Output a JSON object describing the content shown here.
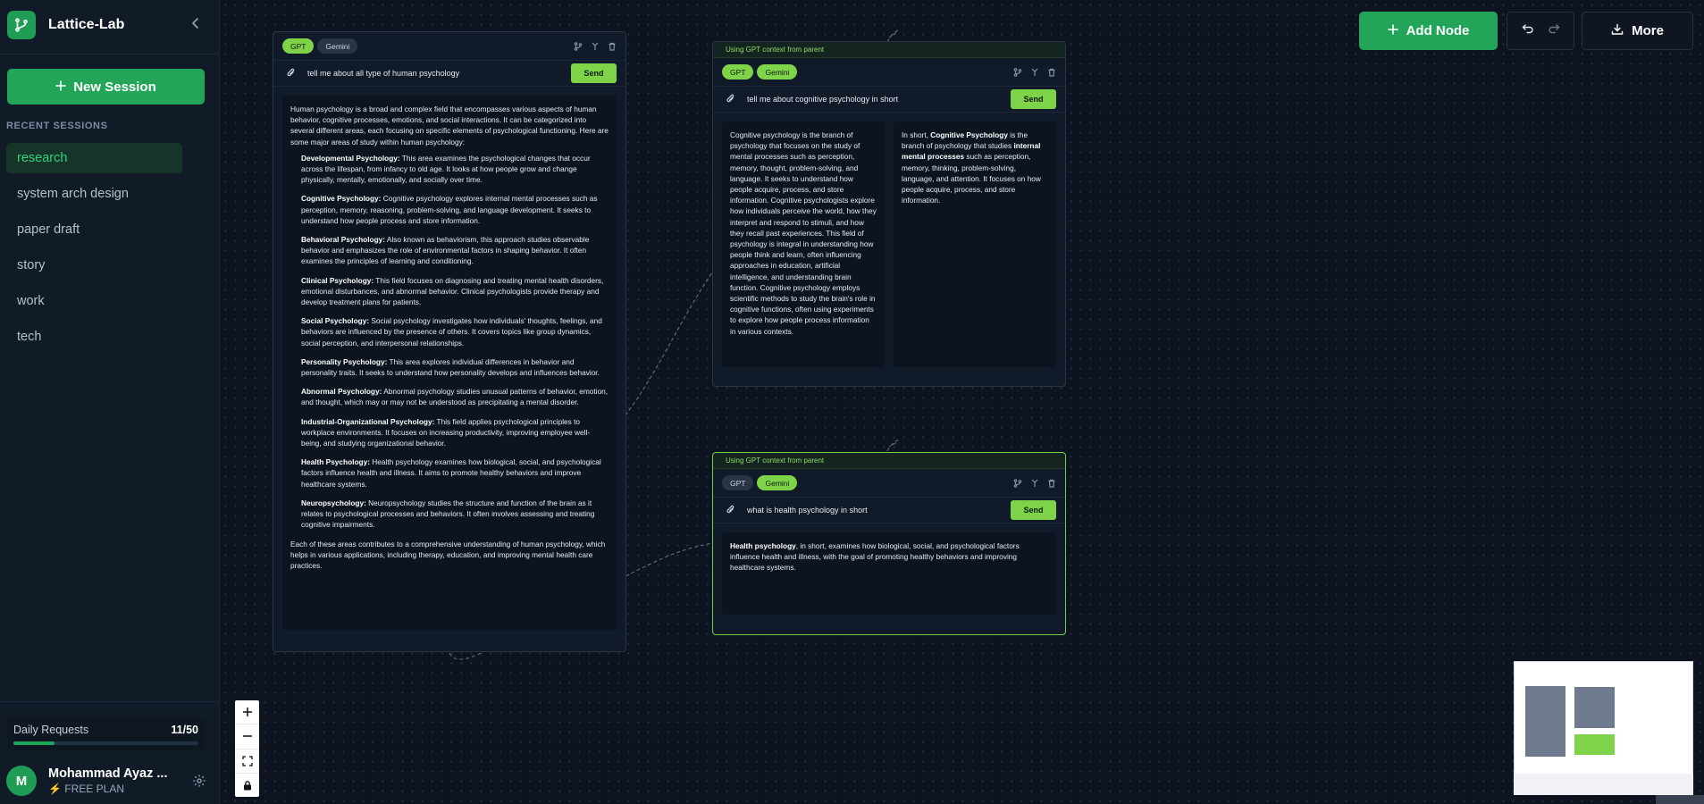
{
  "app": {
    "name": "Lattice-Lab",
    "new_session_label": "New Session",
    "recent_sessions_label": "RECENT SESSIONS",
    "sessions": [
      "research",
      "system arch design",
      "paper draft",
      "story",
      "work",
      "tech"
    ],
    "active_session": "research"
  },
  "usage": {
    "label": "Daily Requests",
    "count": "11/50",
    "fraction": 0.22
  },
  "user": {
    "avatar_initial": "M",
    "name": "Mohammad Ayaz ...",
    "plan": "FREE PLAN"
  },
  "toolbar": {
    "add_node_label": "Add Node",
    "more_label": "More"
  },
  "colors": {
    "accent": "#22a559",
    "chip_active": "#7ed348",
    "canvas_bg": "#0d1420"
  },
  "nodes": {
    "n1": {
      "chips": [
        "GPT",
        "Gemini"
      ],
      "prompt": "tell me about all type of human psychology",
      "send_label": "Send",
      "intro": "Human psychology is a broad and complex field that encompasses various aspects of human behavior, cognitive processes, emotions, and social interactions. It can be categorized into several different areas, each focusing on specific elements of psychological functioning. Here are some major areas of study within human psychology:",
      "items": [
        {
          "title": "Developmental Psychology:",
          "text": " This area examines the psychological changes that occur across the lifespan, from infancy to old age. It looks at how people grow and change physically, mentally, emotionally, and socially over time."
        },
        {
          "title": "Cognitive Psychology:",
          "text": " Cognitive psychology explores internal mental processes such as perception, memory, reasoning, problem-solving, and language development. It seeks to understand how people process and store information."
        },
        {
          "title": "Behavioral Psychology:",
          "text": " Also known as behaviorism, this approach studies observable behavior and emphasizes the role of environmental factors in shaping behavior. It often examines the principles of learning and conditioning."
        },
        {
          "title": "Clinical Psychology:",
          "text": " This field focuses on diagnosing and treating mental health disorders, emotional disturbances, and abnormal behavior. Clinical psychologists provide therapy and develop treatment plans for patients."
        },
        {
          "title": "Social Psychology:",
          "text": " Social psychology investigates how individuals' thoughts, feelings, and behaviors are influenced by the presence of others. It covers topics like group dynamics, social perception, and interpersonal relationships."
        },
        {
          "title": "Personality Psychology:",
          "text": " This area explores individual differences in behavior and personality traits. It seeks to understand how personality develops and influences behavior."
        },
        {
          "title": "Abnormal Psychology:",
          "text": " Abnormal psychology studies unusual patterns of behavior, emotion, and thought, which may or may not be understood as precipitating a mental disorder."
        },
        {
          "title": "Industrial-Organizational Psychology:",
          "text": " This field applies psychological principles to workplace environments. It focuses on increasing productivity, improving employee well-being, and studying organizational behavior."
        },
        {
          "title": "Health Psychology:",
          "text": " Health psychology examines how biological, social, and psychological factors influence health and illness. It aims to promote healthy behaviors and improve healthcare systems."
        },
        {
          "title": "Neuropsychology:",
          "text": " Neuropsychology studies the structure and function of the brain as it relates to psychological processes and behaviors. It often involves assessing and treating cognitive impairments."
        }
      ],
      "outro": "Each of these areas contributes to a comprehensive understanding of human psychology, which helps in various applications, including therapy, education, and improving mental health care practices."
    },
    "n2": {
      "context_label": "Using GPT context from parent",
      "chips": [
        "GPT",
        "Gemini"
      ],
      "prompt": "tell me about cognitive psychology in short",
      "send_label": "Send",
      "response_gpt": "Cognitive psychology is the branch of psychology that focuses on the study of mental processes such as perception, memory, thought, problem-solving, and language. It seeks to understand how people acquire, process, and store information. Cognitive psychologists explore how individuals perceive the world, how they interpret and respond to stimuli, and how they recall past experiences. This field of psychology is integral in understanding how people think and learn, often influencing approaches in education, artificial intelligence, and understanding brain function. Cognitive psychology employs scientific methods to study the brain's role in cognitive functions, often using experiments to explore how people process information in various contexts.",
      "response_gemini_pre": "In short, ",
      "response_gemini_b1": "Cognitive Psychology",
      "response_gemini_mid": " is the branch of psychology that studies ",
      "response_gemini_b2": "internal mental processes",
      "response_gemini_post": " such as perception, memory, thinking, problem-solving, language, and attention. It focuses on how people acquire, process, and store information."
    },
    "n3": {
      "context_label": "Using GPT context from parent",
      "chips": [
        "GPT",
        "Gemini"
      ],
      "prompt": "what is health psychology in short",
      "send_label": "Send",
      "response_bold": "Health psychology",
      "response_rest": ", in short, examines how biological, social, and psychological factors influence health and illness, with the goal of promoting healthy behaviors and improving healthcare systems."
    }
  }
}
